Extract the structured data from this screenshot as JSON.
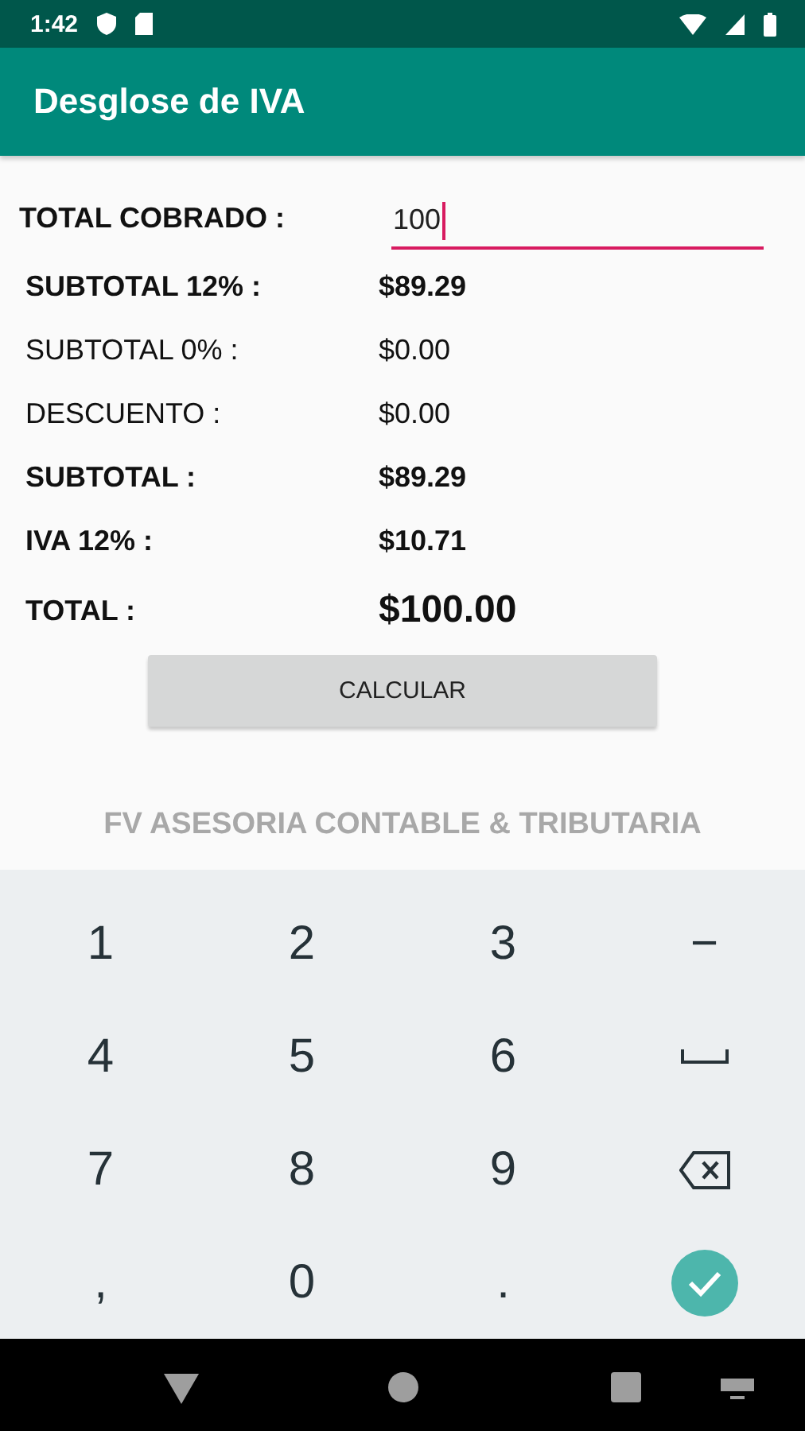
{
  "status_bar": {
    "time": "1:42"
  },
  "app_bar": {
    "title": "Desglose de IVA"
  },
  "form": {
    "input": {
      "label": "TOTAL COBRADO :",
      "value": "100",
      "focused": true
    },
    "rows": [
      {
        "label": "SUBTOTAL 12% :",
        "value": "$89.29",
        "kind": "bold"
      },
      {
        "label": "SUBTOTAL 0% :",
        "value": "$0.00",
        "kind": "plain"
      },
      {
        "label": "DESCUENTO :",
        "value": "$0.00",
        "kind": "plain"
      },
      {
        "label": "SUBTOTAL :",
        "value": "$89.29",
        "kind": "bold"
      },
      {
        "label": "IVA 12% :",
        "value": "$10.71",
        "kind": "bold"
      },
      {
        "label": "TOTAL :",
        "value": "$100.00",
        "kind": "total"
      }
    ],
    "button": "CALCULAR",
    "footer": "FV ASESORIA CONTABLE & TRIBUTARIA"
  },
  "keyboard": {
    "keys": [
      {
        "kind": "text",
        "label": "1"
      },
      {
        "kind": "text",
        "label": "2"
      },
      {
        "kind": "text",
        "label": "3"
      },
      {
        "kind": "text",
        "label": "−"
      },
      {
        "kind": "text",
        "label": "4"
      },
      {
        "kind": "text",
        "label": "5"
      },
      {
        "kind": "text",
        "label": "6"
      },
      {
        "kind": "space"
      },
      {
        "kind": "text",
        "label": "7"
      },
      {
        "kind": "text",
        "label": "8"
      },
      {
        "kind": "text",
        "label": "9"
      },
      {
        "kind": "backspace"
      },
      {
        "kind": "text",
        "label": ","
      },
      {
        "kind": "text",
        "label": "0"
      },
      {
        "kind": "text",
        "label": "."
      },
      {
        "kind": "done"
      }
    ]
  }
}
